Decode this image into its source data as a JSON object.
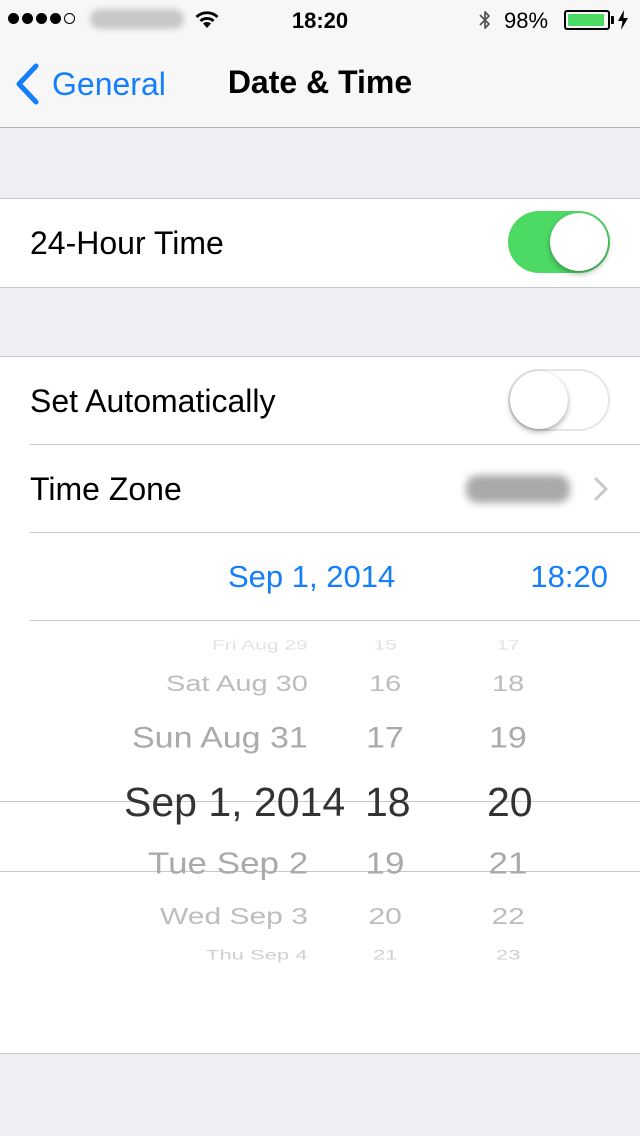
{
  "status_bar": {
    "time": "18:20",
    "battery_percent": "98%",
    "battery_level": 0.98,
    "icons": [
      "signal-dots-icon",
      "wifi-icon",
      "bluetooth-icon",
      "battery-icon",
      "charging-bolt-icon"
    ]
  },
  "nav": {
    "back_label": "General",
    "title": "Date & Time"
  },
  "rows": {
    "hour24": {
      "label": "24-Hour Time",
      "on": true
    },
    "set_auto": {
      "label": "Set Automatically",
      "on": false
    },
    "time_zone": {
      "label": "Time Zone"
    },
    "datetime": {
      "date": "Sep 1, 2014",
      "time": "18:20"
    }
  },
  "picker": {
    "dates": [
      "Fri Aug 29",
      "Sat Aug 30",
      "Sun Aug 31",
      "Sep 1, 2014",
      "Tue Sep 2",
      "Wed Sep 3",
      "Thu Sep 4"
    ],
    "hours": [
      "15",
      "16",
      "17",
      "18",
      "19",
      "20",
      "21"
    ],
    "minutes": [
      "17",
      "18",
      "19",
      "20",
      "21",
      "22",
      "23"
    ],
    "selected_index": 3
  },
  "colors": {
    "accent": "#157efb",
    "switch_on": "#4cd964",
    "background": "#efeff4"
  }
}
